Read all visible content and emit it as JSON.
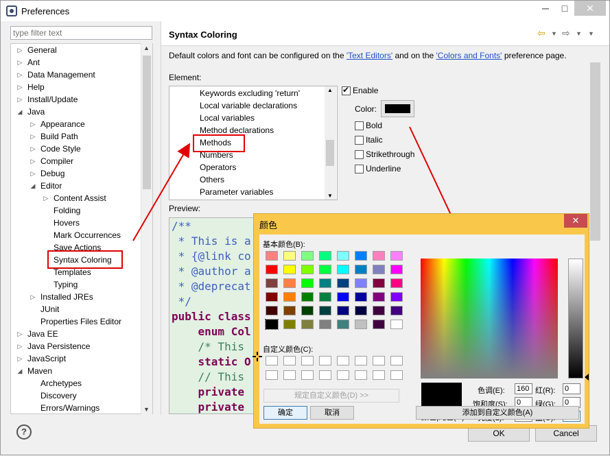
{
  "window": {
    "title": "Preferences",
    "minimize": "─",
    "maximize": "□",
    "close": "✕"
  },
  "filter": {
    "placeholder": "type filter text"
  },
  "tree": {
    "items": [
      {
        "label": "General",
        "twisty": "▷"
      },
      {
        "label": "Ant",
        "twisty": "▷"
      },
      {
        "label": "Data Management",
        "twisty": "▷"
      },
      {
        "label": "Help",
        "twisty": "▷"
      },
      {
        "label": "Install/Update",
        "twisty": "▷"
      },
      {
        "label": "Java",
        "twisty": "◢"
      },
      {
        "label": "Appearance",
        "twisty": "▷"
      },
      {
        "label": "Build Path",
        "twisty": "▷"
      },
      {
        "label": "Code Style",
        "twisty": "▷"
      },
      {
        "label": "Compiler",
        "twisty": "▷"
      },
      {
        "label": "Debug",
        "twisty": "▷"
      },
      {
        "label": "Editor",
        "twisty": "◢"
      },
      {
        "label": "Content Assist",
        "twisty": "▷"
      },
      {
        "label": "Folding",
        "twisty": ""
      },
      {
        "label": "Hovers",
        "twisty": ""
      },
      {
        "label": "Mark Occurrences",
        "twisty": ""
      },
      {
        "label": "Save Actions",
        "twisty": ""
      },
      {
        "label": "Syntax Coloring",
        "twisty": ""
      },
      {
        "label": "Templates",
        "twisty": ""
      },
      {
        "label": "Typing",
        "twisty": ""
      },
      {
        "label": "Installed JREs",
        "twisty": "▷"
      },
      {
        "label": "JUnit",
        "twisty": ""
      },
      {
        "label": "Properties Files Editor",
        "twisty": ""
      },
      {
        "label": "Java EE",
        "twisty": "▷"
      },
      {
        "label": "Java Persistence",
        "twisty": "▷"
      },
      {
        "label": "JavaScript",
        "twisty": "▷"
      },
      {
        "label": "Maven",
        "twisty": "◢"
      },
      {
        "label": "Archetypes",
        "twisty": ""
      },
      {
        "label": "Discovery",
        "twisty": ""
      },
      {
        "label": "Errors/Warnings",
        "twisty": ""
      }
    ]
  },
  "page": {
    "title": "Syntax Coloring",
    "nav_back": "⇦",
    "nav_forward": "⇨",
    "description_prefix": "Default colors and font can be configured on the ",
    "link_text_editors": "'Text Editors'",
    "description_middle": " and on the ",
    "link_colors_fonts": "'Colors and Fonts'",
    "description_suffix": " preference page.",
    "element_label": "Element:",
    "preview_label": "Preview:"
  },
  "elements": {
    "items": [
      "Keywords excluding 'return'",
      "Local variable declarations",
      "Local variables",
      "Method declarations",
      "Methods",
      "Numbers",
      "Operators",
      "Others",
      "Parameter variables"
    ],
    "selected": "Methods"
  },
  "options": {
    "enable": "Enable",
    "color": "Color:",
    "bold": "Bold",
    "italic": "Italic",
    "strikethrough": "Strikethrough",
    "underline": "Underline"
  },
  "preview": {
    "lines": [
      {
        "text": "/**",
        "color": "#3f5fbf"
      },
      {
        "text": " * This is a",
        "color": "#3f5fbf"
      },
      {
        "text": " * {@link co",
        "color": "#3f5fbf"
      },
      {
        "text": " * @author a",
        "color": "#3f5fbf"
      },
      {
        "text": " * @deprecat",
        "color": "#3f5fbf"
      },
      {
        "text": " */",
        "color": "#3f5fbf"
      },
      {
        "text": "public class",
        "color": "#7f0055"
      },
      {
        "text": "    enum Col",
        "color": "#7f0055"
      },
      {
        "text": "    /* This ",
        "color": "#3f7f5f"
      },
      {
        "text": "    static O",
        "color": "#7f0055"
      },
      {
        "text": "    // This ",
        "color": "#3f7f5f"
      },
      {
        "text": "    private ",
        "color": "#7f0055"
      },
      {
        "text": "    private ",
        "color": "#7f0055"
      }
    ]
  },
  "buttons": {
    "ok": "OK",
    "cancel": "Cancel",
    "help": "?"
  },
  "dialog": {
    "title": "颜色",
    "close": "✕",
    "basic_colors_label": "基本颜色(B):",
    "custom_colors_label": "自定义颜色(C):",
    "define_custom": "规定自定义颜色(D) >>",
    "ok": "确定",
    "cancel": "取消",
    "add_custom": "添加到自定义颜色(A)",
    "color_solid": "颜色|纯色(O)",
    "hue_label": "色调(E):",
    "hue": "160",
    "sat_label": "饱和度(S):",
    "sat": "0",
    "lum_label": "亮度(L):",
    "lum": "0",
    "red_label": "红(R):",
    "red": "0",
    "green_label": "绿(G):",
    "green": "0",
    "blue_label": "蓝(U):",
    "blue": "0",
    "basic_colors": [
      "#ff8080",
      "#ffff80",
      "#80ff80",
      "#00ff80",
      "#80ffff",
      "#0080ff",
      "#ff80c0",
      "#ff80ff",
      "#ff0000",
      "#ffff00",
      "#80ff00",
      "#00ff40",
      "#00ffff",
      "#0080c0",
      "#8080c0",
      "#ff00ff",
      "#804040",
      "#ff8040",
      "#00ff00",
      "#008080",
      "#004080",
      "#8080ff",
      "#800040",
      "#ff0080",
      "#800000",
      "#ff8000",
      "#008000",
      "#008040",
      "#0000ff",
      "#0000a0",
      "#800080",
      "#8000ff",
      "#400000",
      "#804000",
      "#004000",
      "#004040",
      "#000080",
      "#000040",
      "#400040",
      "#400080",
      "#000000",
      "#808000",
      "#808040",
      "#808080",
      "#408080",
      "#c0c0c0",
      "#400040",
      "#ffffff"
    ]
  }
}
